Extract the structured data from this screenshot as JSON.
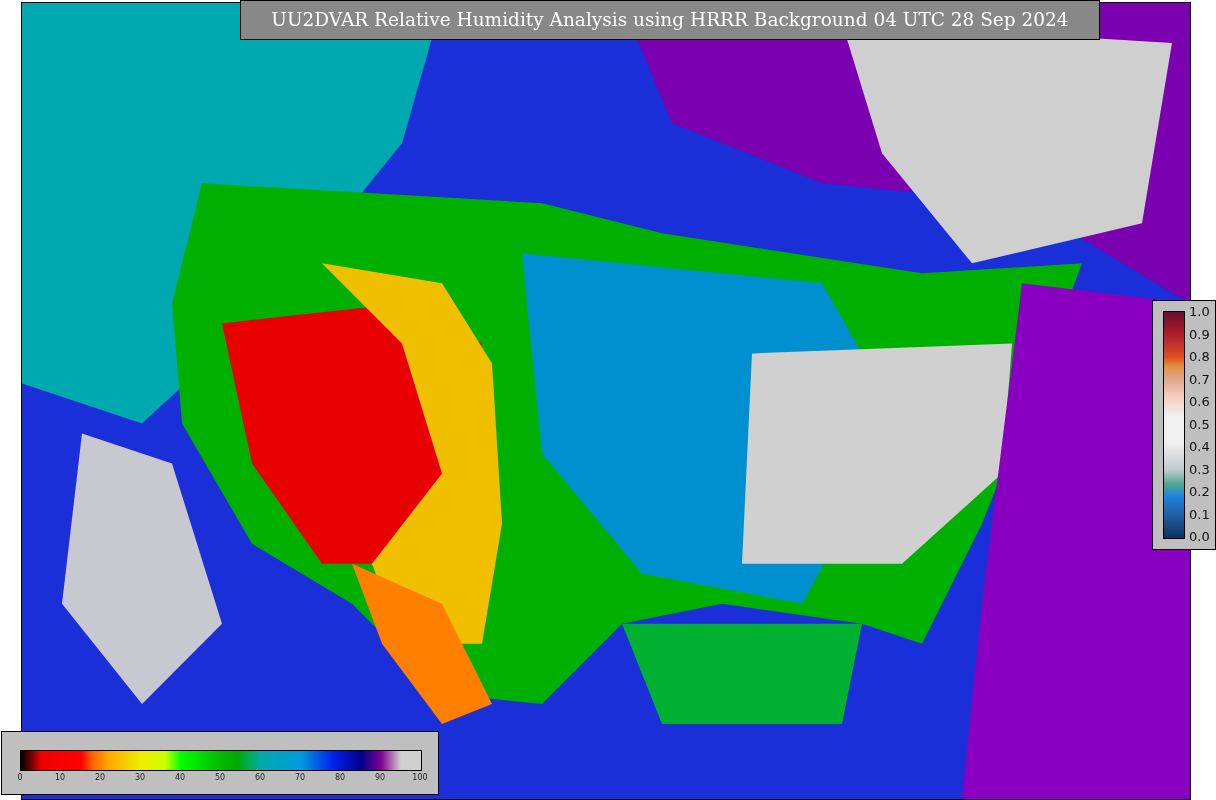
{
  "title": "UU2DVAR Relative Humidity Analysis using HRRR Background 04 UTC 28 Sep 2024",
  "humidity_legend": {
    "ticks": [
      "0",
      "10",
      "20",
      "30",
      "40",
      "50",
      "60",
      "70",
      "80",
      "90",
      "100"
    ]
  },
  "observation_legend": {
    "ticks": [
      "1.0",
      "0.9",
      "0.8",
      "0.7",
      "0.6",
      "0.5",
      "0.4",
      "0.3",
      "0.2",
      "0.1",
      "0.0"
    ]
  }
}
